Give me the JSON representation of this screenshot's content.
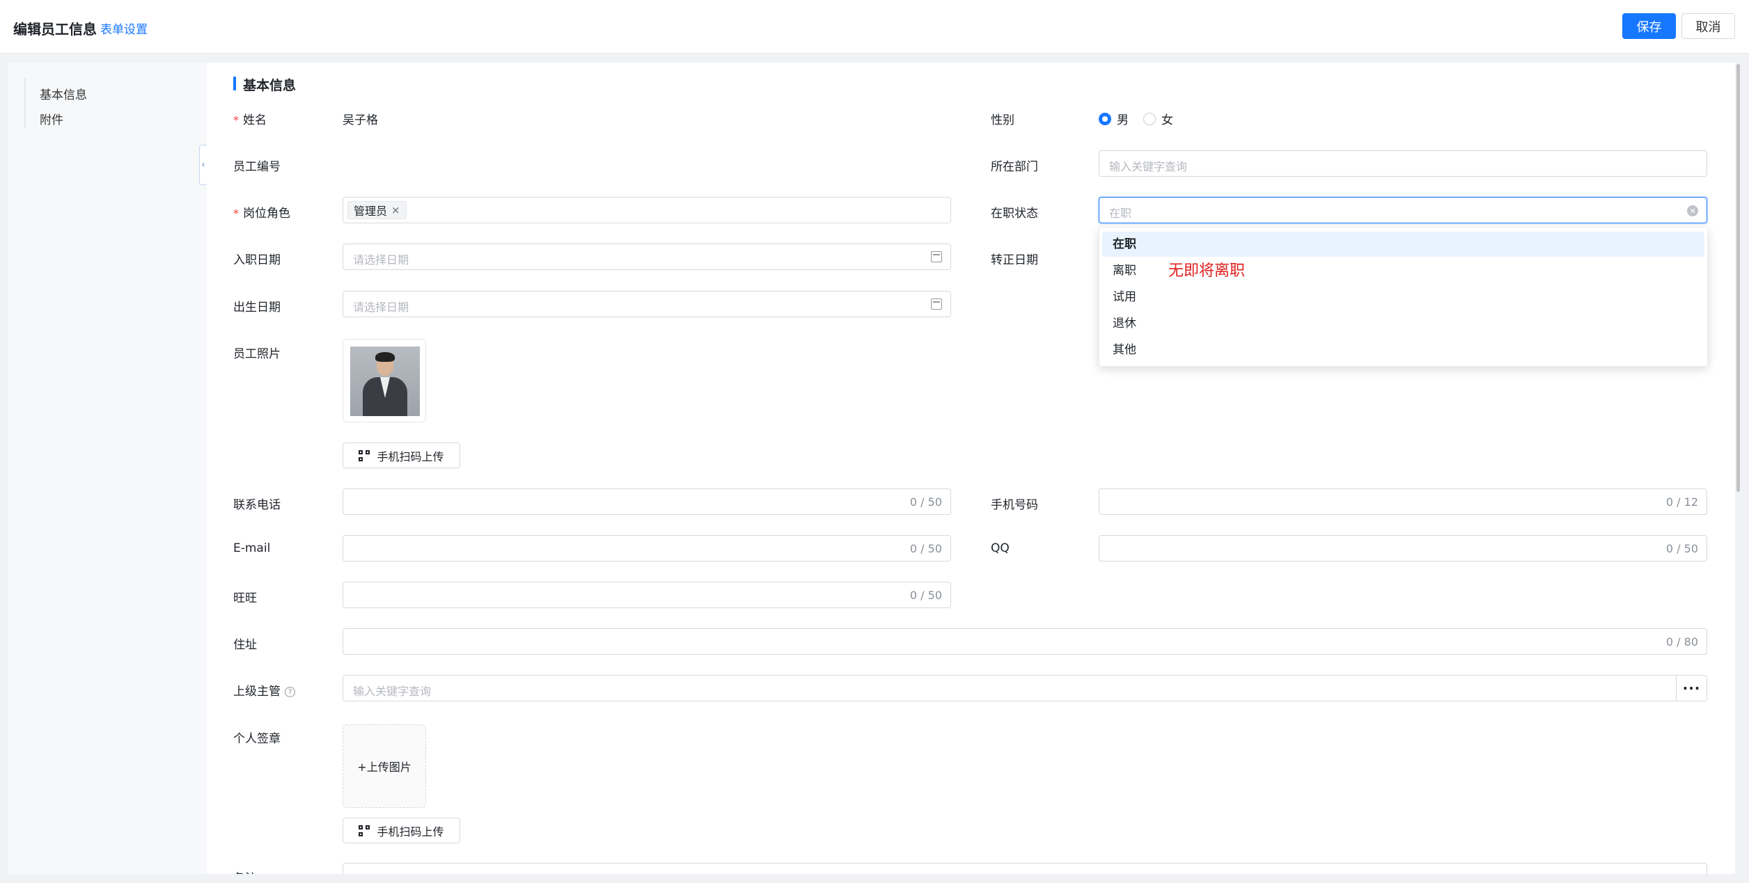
{
  "header": {
    "title": "编辑员工信息",
    "form_settings": "表单设置",
    "save": "保存",
    "cancel": "取消"
  },
  "sidebar": {
    "items": [
      {
        "label": "基本信息"
      },
      {
        "label": "附件"
      }
    ]
  },
  "section": {
    "title": "基本信息"
  },
  "fields": {
    "name": {
      "label": "姓名",
      "value": "吴子格",
      "required": true
    },
    "gender": {
      "label": "性别",
      "options": [
        "男",
        "女"
      ],
      "selected": "男"
    },
    "employee_no": {
      "label": "员工编号"
    },
    "department": {
      "label": "所在部门",
      "placeholder": "输入关键字查询"
    },
    "role": {
      "label": "岗位角色",
      "tag": "管理员",
      "required": true
    },
    "status": {
      "label": "在职状态",
      "placeholder": "在职"
    },
    "hire_date": {
      "label": "入职日期",
      "placeholder": "请选择日期"
    },
    "regular_date": {
      "label": "转正日期"
    },
    "birth_date": {
      "label": "出生日期",
      "placeholder": "请选择日期"
    },
    "photo": {
      "label": "员工照片"
    },
    "scan_upload": "手机扫码上传",
    "phone": {
      "label": "联系电话",
      "counter": "0 / 50"
    },
    "mobile": {
      "label": "手机号码",
      "counter": "0 / 12"
    },
    "email": {
      "label": "E-mail",
      "counter": "0 / 50"
    },
    "qq": {
      "label": "QQ",
      "counter": "0 / 50"
    },
    "wangwang": {
      "label": "旺旺",
      "counter": "0 / 50"
    },
    "address": {
      "label": "住址",
      "counter": "0 / 80"
    },
    "supervisor": {
      "label": "上级主管",
      "placeholder": "输入关键字查询",
      "help": "?",
      "more": "···"
    },
    "signature": {
      "label": "个人签章",
      "upload": "+上传图片"
    },
    "remark": {
      "label": "备注"
    }
  },
  "status_dropdown": {
    "options": [
      "在职",
      "离职",
      "试用",
      "退休",
      "其他"
    ],
    "selected": "在职"
  },
  "annotation": "无即将离职",
  "colors": {
    "primary": "#1677ff",
    "required": "#f53f3f",
    "annotation": "#e02020"
  }
}
